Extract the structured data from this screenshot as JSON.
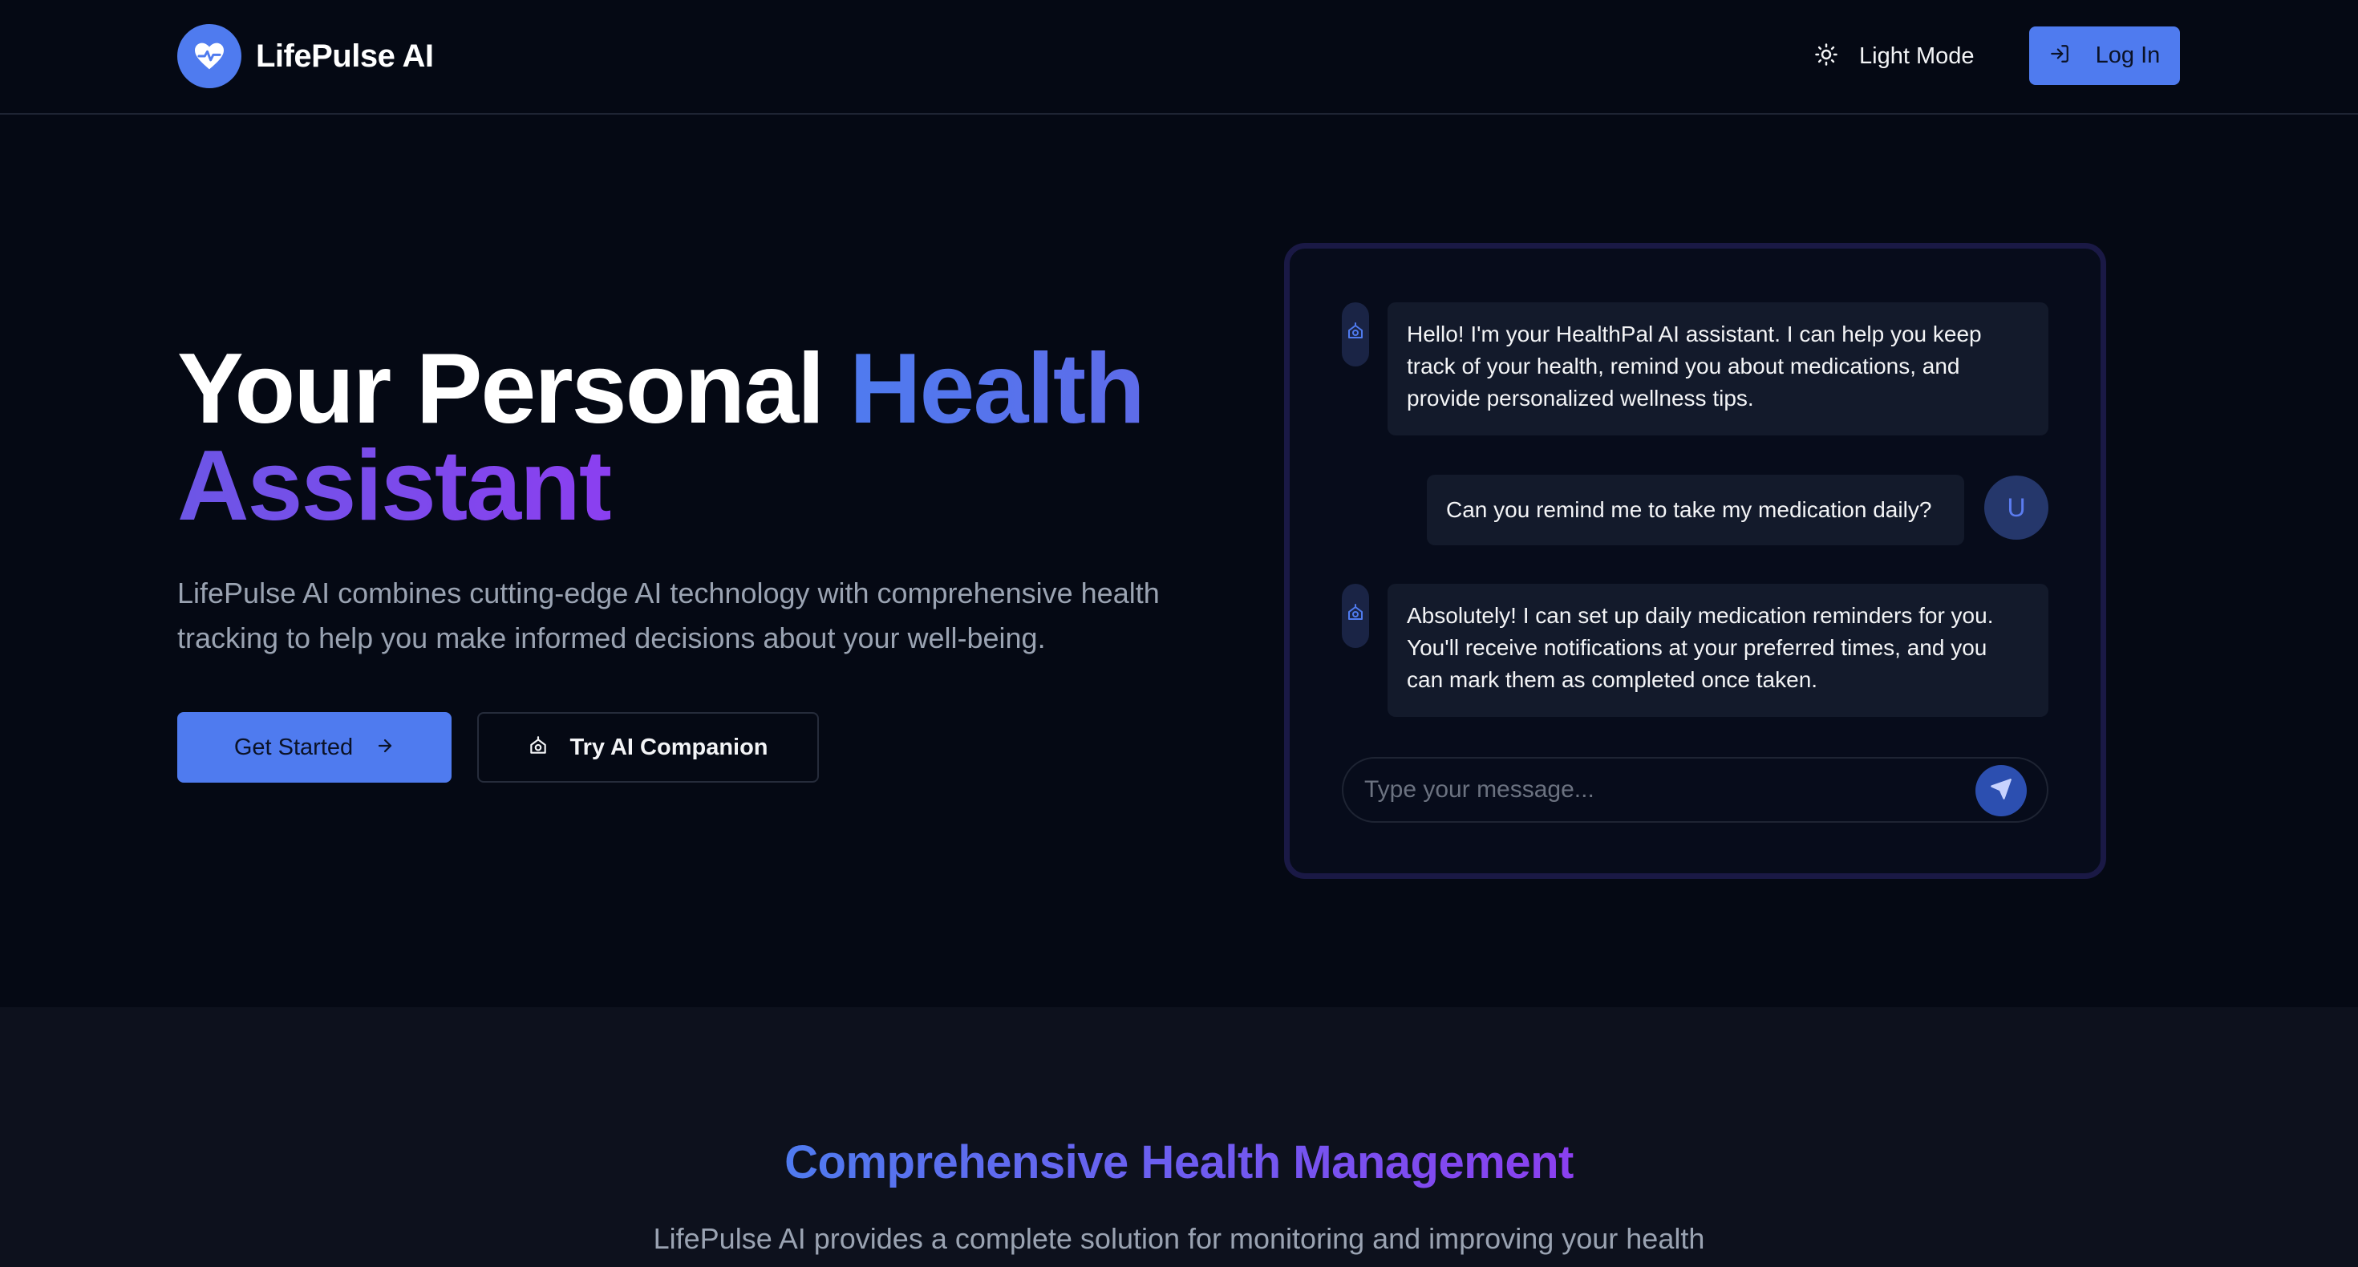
{
  "brand": {
    "name": "LifePulse AI",
    "icon": "heart-pulse-icon"
  },
  "nav": {
    "theme_toggle_label": "Light Mode",
    "theme_icon": "sun-icon",
    "login_label": "Log In",
    "login_icon": "log-in-icon"
  },
  "hero": {
    "title_part1": "Your Personal ",
    "title_part2": "Health",
    "title_part3": "Assistant",
    "description": "LifePulse AI combines cutting-edge AI technology with comprehensive health tracking to help you make informed decisions about your well-being.",
    "primary_button": "Get Started",
    "primary_icon": "arrow-right-icon",
    "secondary_button": "Try AI Companion",
    "secondary_icon": "bot-icon"
  },
  "chat": {
    "messages": [
      {
        "sender": "bot",
        "text": "Hello! I'm your HealthPal AI assistant. I can help you keep track of your health, remind you about medications, and provide personalized wellness tips."
      },
      {
        "sender": "user",
        "avatar": "U",
        "text": "Can you remind me to take my medication daily?"
      },
      {
        "sender": "bot",
        "text": "Absolutely! I can set up daily medication reminders for you. You'll receive notifications at your preferred times, and you can mark them as completed once taken."
      }
    ],
    "input_placeholder": "Type your message...",
    "send_icon": "send-icon"
  },
  "features": {
    "title": "Comprehensive Health Management",
    "subtitle": "LifePulse AI provides a complete solution for monitoring and improving your health"
  },
  "colors": {
    "background": "#050914",
    "accent": "#4f7bef",
    "accent_purple": "#8b3ff0",
    "section_bg": "#0d111d"
  }
}
